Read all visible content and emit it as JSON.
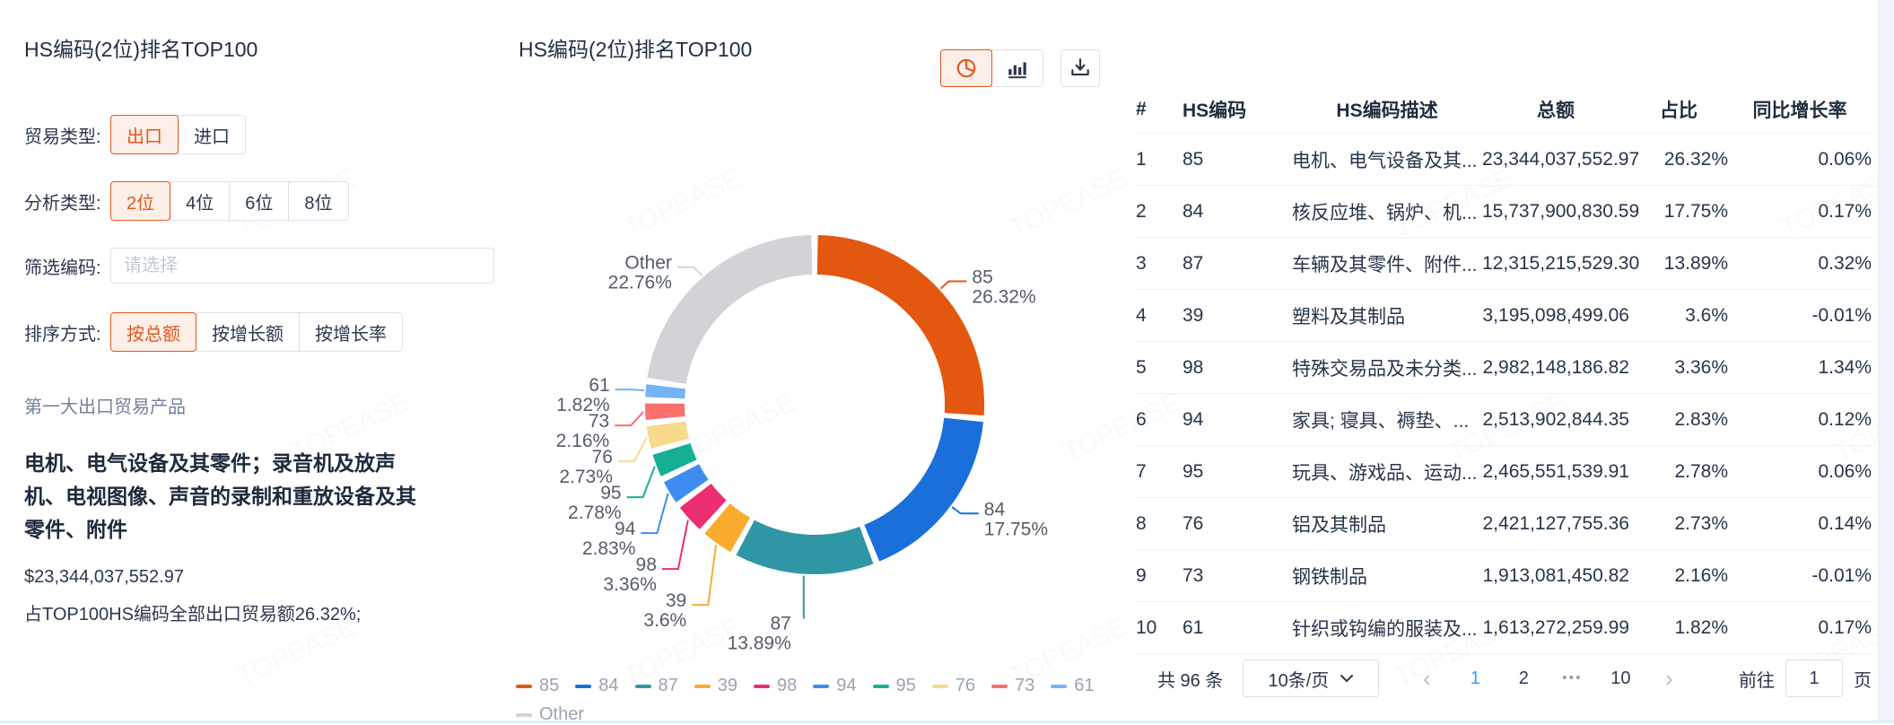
{
  "watermark": "TOPEASE",
  "colors": {
    "accent": "#E4571C",
    "active_page": "#3E9BF4"
  },
  "left_panel": {
    "title": "HS编码(2位)排名TOP100",
    "trade_type": {
      "label": "贸易类型:",
      "options": [
        "出口",
        "进口"
      ],
      "selected": "出口"
    },
    "analysis_type": {
      "label": "分析类型:",
      "options": [
        "2位",
        "4位",
        "6位",
        "8位"
      ],
      "selected": "2位"
    },
    "filter_code": {
      "label": "筛选编码:",
      "placeholder": "请选择"
    },
    "sort_mode": {
      "label": "排序方式:",
      "options": [
        "按总额",
        "按增长额",
        "按增长率"
      ],
      "selected": "按总额"
    },
    "summary": {
      "caption": "第一大出口贸易产品",
      "product_name": "电机、电气设备及其零件；录音机及放声机、电视图像、声音的录制和重放设备及其零件、附件",
      "amount": "$23,344,037,552.97",
      "share_note": "占TOP100HS编码全部出口贸易额26.32%;"
    }
  },
  "chart_panel": {
    "title": "HS编码(2位)排名TOP100",
    "toolbar": {
      "view_icons": [
        "pie-chart-icon",
        "bar-chart-icon"
      ],
      "active_view": "pie",
      "download_icon": "download-icon"
    }
  },
  "chart_data": {
    "type": "pie",
    "donut": true,
    "title": "HS编码(2位)排名TOP100",
    "labels": [
      "85",
      "84",
      "87",
      "39",
      "98",
      "94",
      "95",
      "76",
      "73",
      "61",
      "Other"
    ],
    "values": [
      26.32,
      17.75,
      13.89,
      3.6,
      3.36,
      2.83,
      2.78,
      2.73,
      2.16,
      1.82,
      22.76
    ],
    "colors": [
      "#E45710",
      "#1B6FDB",
      "#2E96A5",
      "#FAAB2E",
      "#ED2D72",
      "#3D8DF0",
      "#15B093",
      "#F8DA8C",
      "#F8706C",
      "#74B3F5",
      "#D2D3D6"
    ],
    "label_format": "name + percent",
    "legend_position": "bottom"
  },
  "table": {
    "columns": [
      "#",
      "HS编码",
      "HS编码描述",
      "总额",
      "占比",
      "同比增长率"
    ],
    "rows": [
      [
        "1",
        "85",
        "电机、电气设备及其...",
        "23,344,037,552.97",
        "26.32%",
        "0.06%"
      ],
      [
        "2",
        "84",
        "核反应堆、锅炉、机...",
        "15,737,900,830.59",
        "17.75%",
        "0.17%"
      ],
      [
        "3",
        "87",
        "车辆及其零件、附件...",
        "12,315,215,529.30",
        "13.89%",
        "0.32%"
      ],
      [
        "4",
        "39",
        "塑料及其制品",
        "3,195,098,499.06",
        "3.6%",
        "-0.01%"
      ],
      [
        "5",
        "98",
        "特殊交易品及未分类...",
        "2,982,148,186.82",
        "3.36%",
        "1.34%"
      ],
      [
        "6",
        "94",
        "家具; 寝具、褥垫、...",
        "2,513,902,844.35",
        "2.83%",
        "0.12%"
      ],
      [
        "7",
        "95",
        "玩具、游戏品、运动...",
        "2,465,551,539.91",
        "2.78%",
        "0.06%"
      ],
      [
        "8",
        "76",
        "铝及其制品",
        "2,421,127,755.36",
        "2.73%",
        "0.14%"
      ],
      [
        "9",
        "73",
        "钢铁制品",
        "1,913,081,450.82",
        "2.16%",
        "-0.01%"
      ],
      [
        "10",
        "61",
        "针织或钩编的服装及...",
        "1,613,272,259.99",
        "1.82%",
        "0.17%"
      ]
    ],
    "pagination": {
      "total": "共 96 条",
      "page_size": "10条/页",
      "pages": [
        "1",
        "2",
        "•••",
        "10"
      ],
      "current": "1",
      "goto_label": "前往",
      "goto_value": "1",
      "goto_suffix": "页"
    }
  }
}
